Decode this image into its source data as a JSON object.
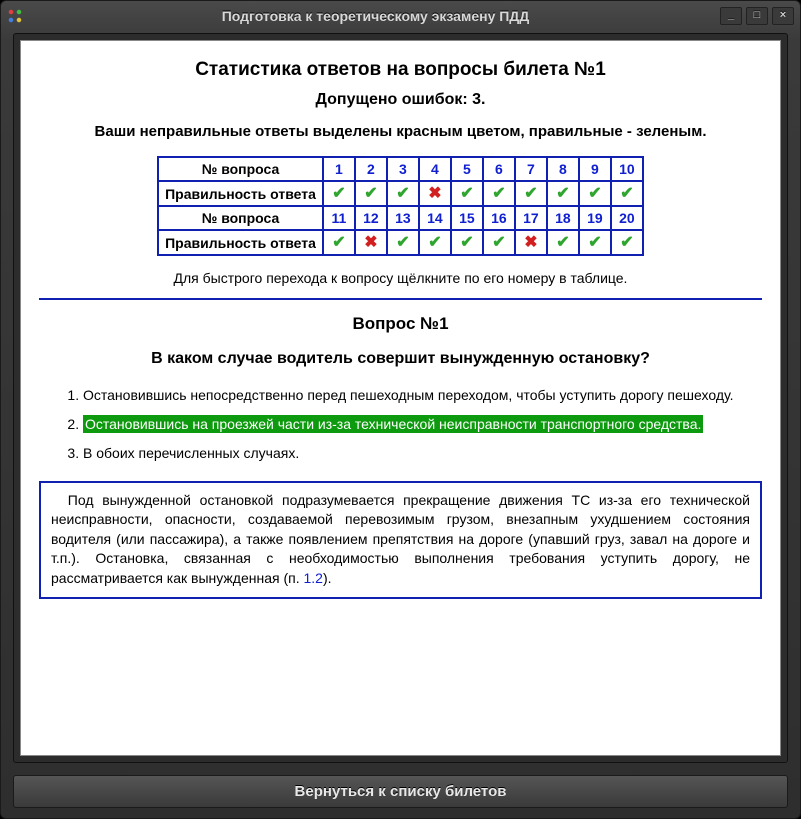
{
  "window": {
    "title": "Подготовка к теоретическому экзамену ПДД"
  },
  "stats": {
    "heading": "Статистика ответов на вопросы билета №1",
    "mistakes_line": "Допущено ошибок: 3.",
    "legend": "Ваши неправильные ответы выделены красным цветом, правильные - зеленым.",
    "row_label_q": "№ вопроса",
    "row_label_a": "Правильность ответа",
    "row1": {
      "nums": [
        "1",
        "2",
        "3",
        "4",
        "5",
        "6",
        "7",
        "8",
        "9",
        "10"
      ],
      "ok": [
        true,
        true,
        true,
        false,
        true,
        true,
        true,
        true,
        true,
        true
      ]
    },
    "row2": {
      "nums": [
        "11",
        "12",
        "13",
        "14",
        "15",
        "16",
        "17",
        "18",
        "19",
        "20"
      ],
      "ok": [
        true,
        false,
        true,
        true,
        true,
        true,
        false,
        true,
        true,
        true
      ]
    },
    "quickjump": "Для быстрого перехода к вопросу щёлкните по его номеру в таблице."
  },
  "question": {
    "title": "Вопрос №1",
    "text": "В каком случае водитель совершит вынужденную остановку?",
    "answers": [
      {
        "text": "Остановившись непосредственно перед пешеходным переходом, чтобы уступить дорогу пешеходу.",
        "correct": false,
        "user_wrong": false
      },
      {
        "text": "Остановившись на проезжей части из-за технической неисправности транспортного средства.",
        "correct": true,
        "user_wrong": false
      },
      {
        "text": "В обоих перечисленных случаях.",
        "correct": false,
        "user_wrong": false
      }
    ],
    "explanation_pre": "Под вынужденной остановкой подразумевается прекращение движения ТС из-за его технической неисправности, опасности, создаваемой перевозимым грузом, внезапным ухудшением состояния водителя (или пассажира), а также появлением препятствия на дороге (упавший груз, завал на дороге и т.п.). Остановка, связанная с необходимостью выполнения требования уступить дорогу, не рассматривается как вынужденная (п. ",
    "explanation_ref": "1.2",
    "explanation_post": ")."
  },
  "footer": {
    "return_label": "Вернуться к списку билетов"
  }
}
